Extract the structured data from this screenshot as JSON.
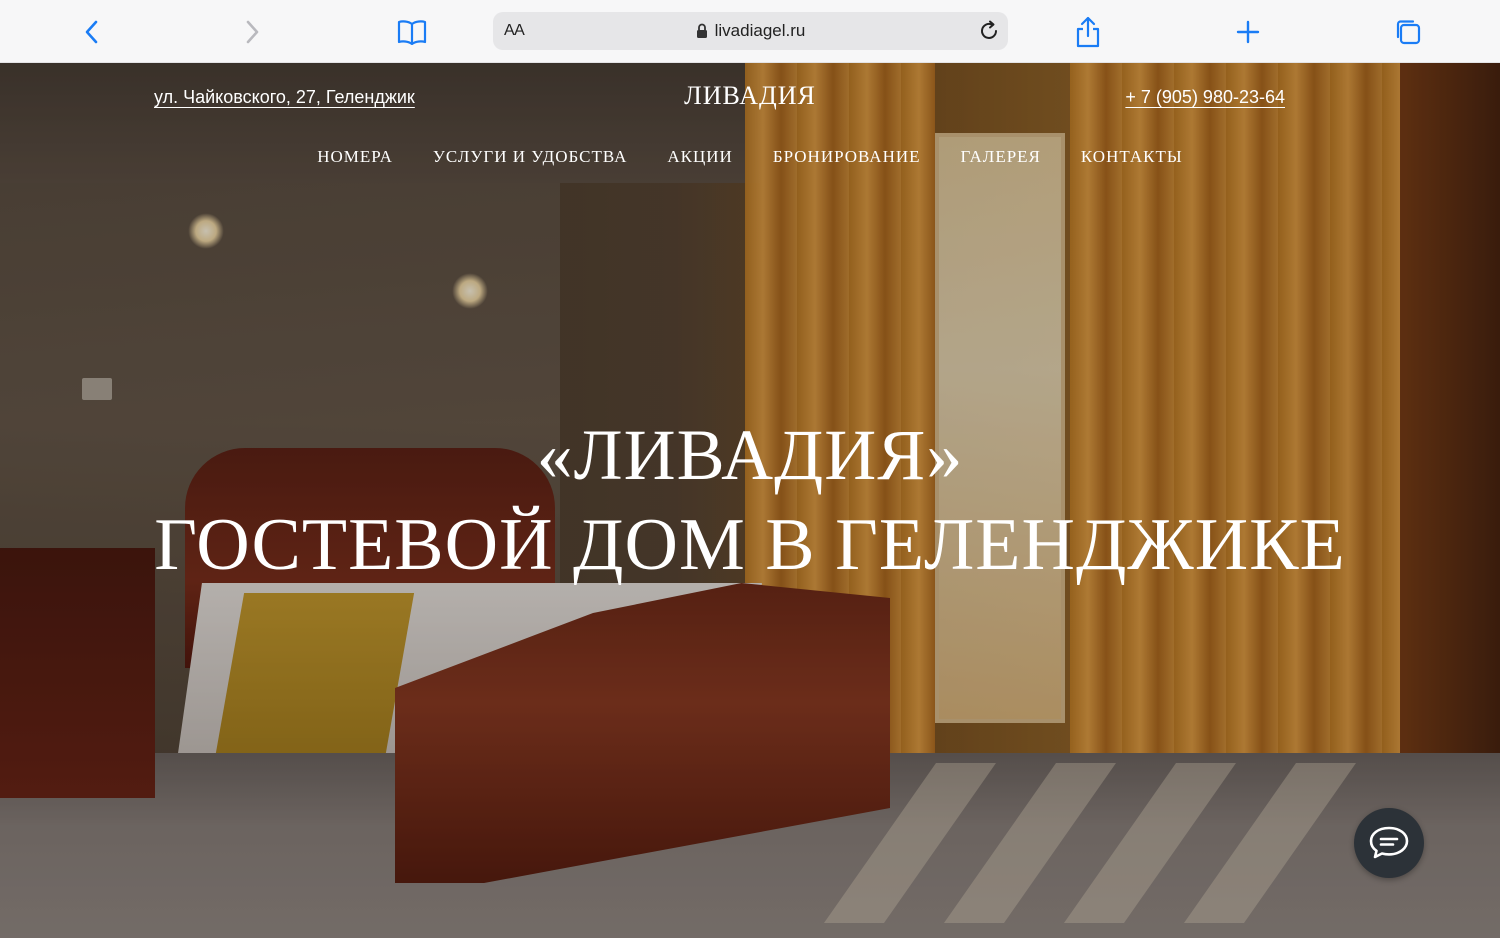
{
  "browser": {
    "reader_label": "AA",
    "url": "livadiagel.ru",
    "accent_color": "#1a7cf5"
  },
  "site": {
    "address": "ул. Чайковского, 27, Геленджик",
    "logo": "ЛИВАДИЯ",
    "phone": "+ 7 (905) 980-23-64",
    "nav": [
      {
        "label": "НОМЕРА"
      },
      {
        "label": "УСЛУГИ И УДОБСТВА"
      },
      {
        "label": "АКЦИИ"
      },
      {
        "label": "БРОНИРОВАНИЕ"
      },
      {
        "label": "ГАЛЕРЕЯ"
      },
      {
        "label": "КОНТАКТЫ"
      }
    ],
    "headline_line1": "«ЛИВАДИЯ»",
    "headline_line2": "ГОСТЕВОЙ ДОМ В ГЕЛЕНДЖИКЕ"
  },
  "icons": {
    "back": "chevron-left-icon",
    "forward": "chevron-right-icon",
    "bookmarks": "book-icon",
    "lock": "lock-icon",
    "reload": "reload-icon",
    "share": "share-icon",
    "new_tab": "plus-icon",
    "tabs": "tabs-icon",
    "chat": "chat-icon"
  }
}
